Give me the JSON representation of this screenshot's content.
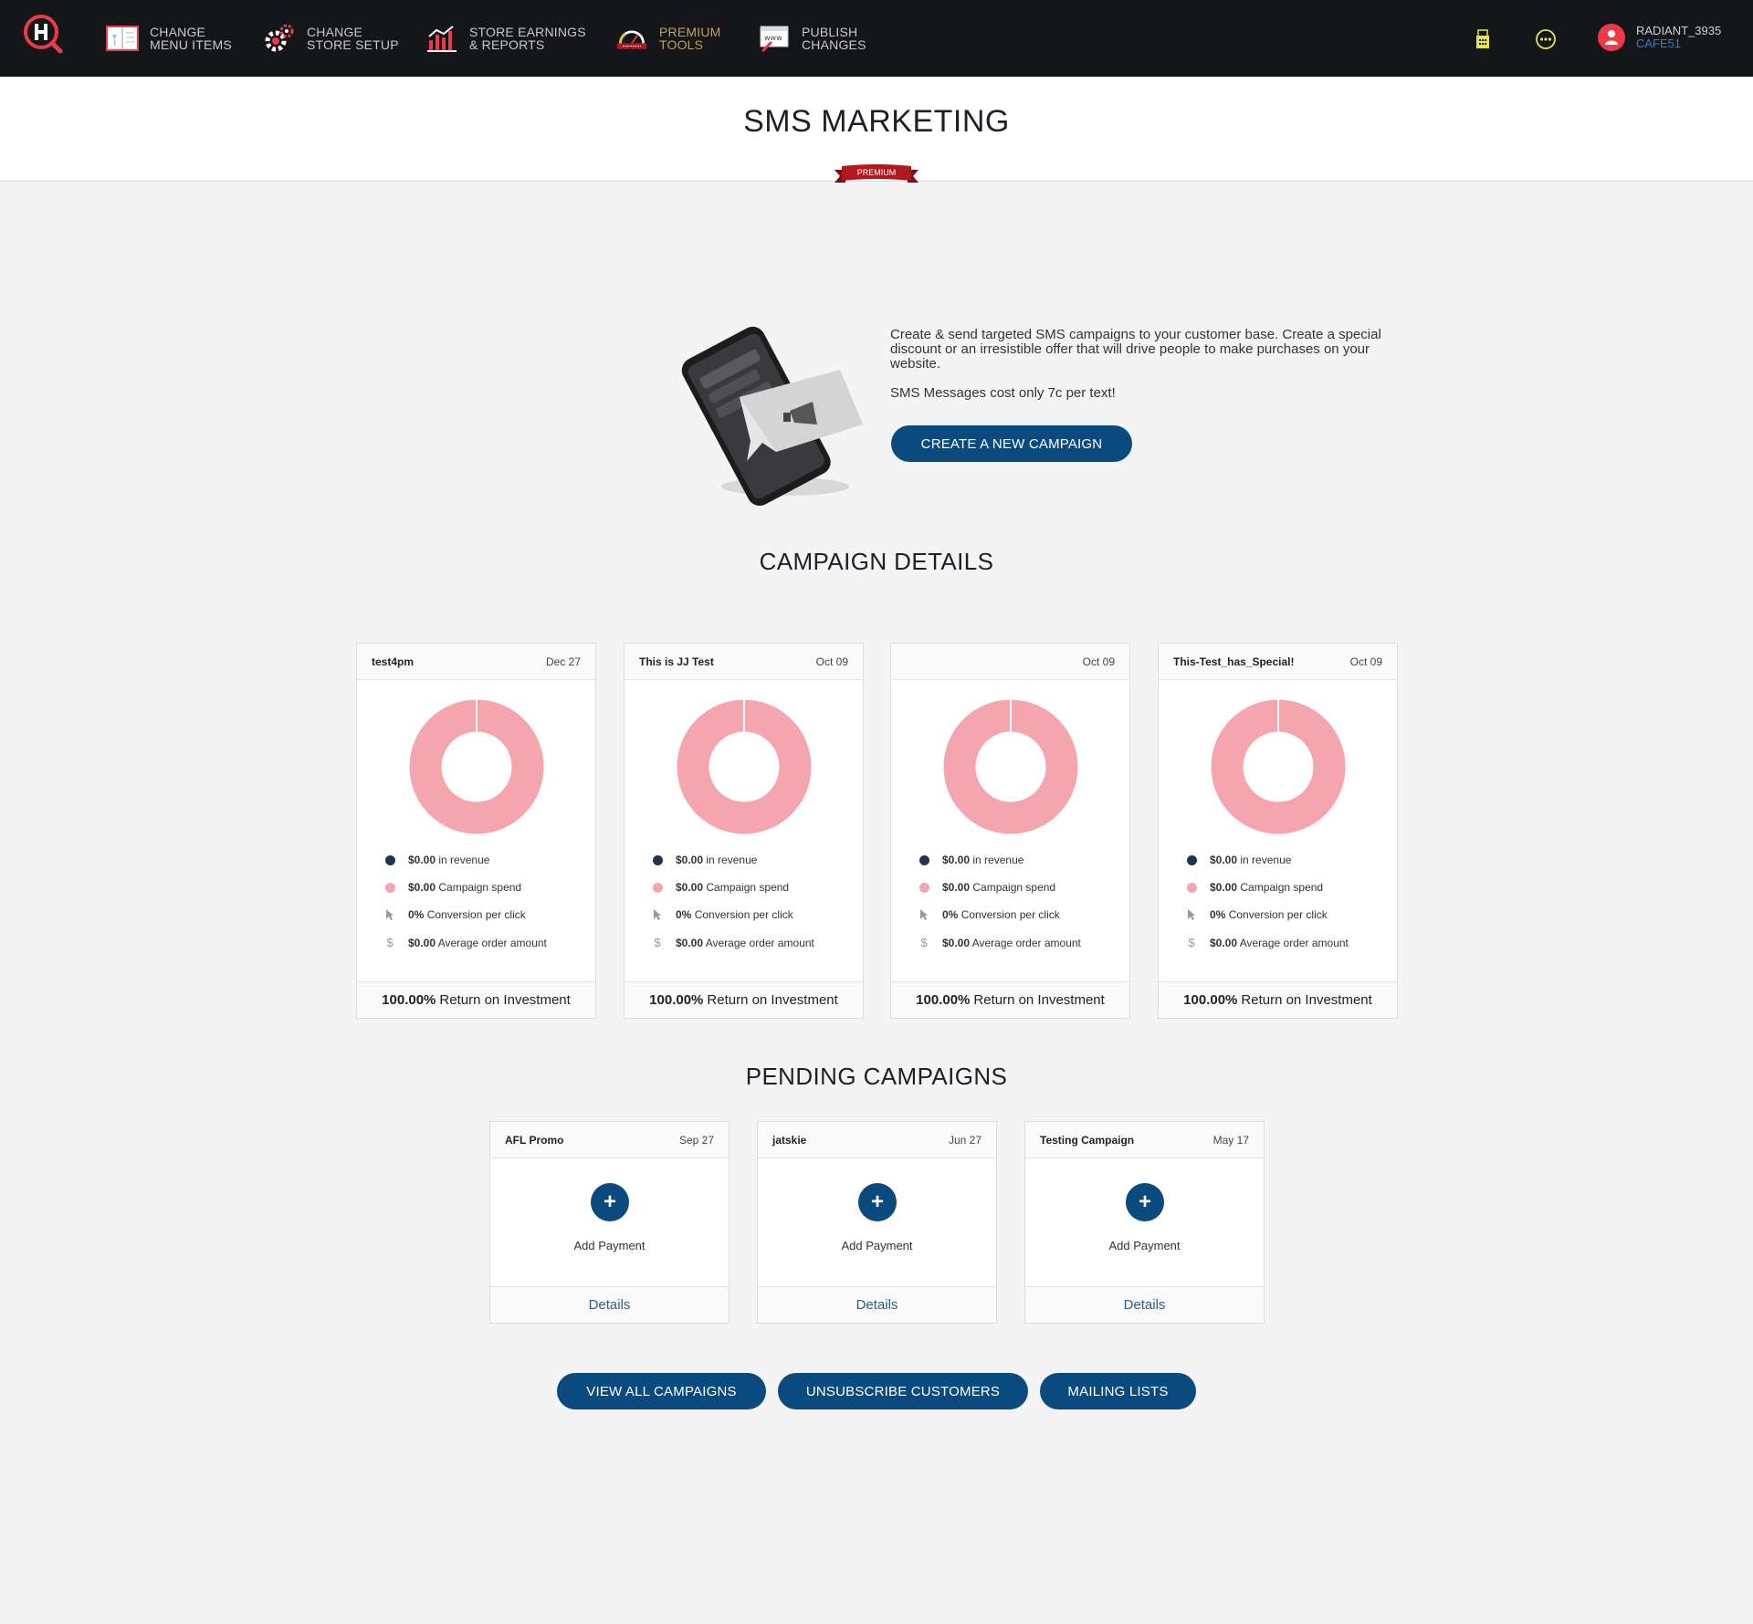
{
  "nav": {
    "items": [
      {
        "line1": "CHANGE",
        "line2": "MENU ITEMS",
        "icon": "menu-book-icon"
      },
      {
        "line1": "CHANGE",
        "line2": "STORE SETUP",
        "icon": "gear-icon"
      },
      {
        "line1": "STORE EARNINGS",
        "line2": "& REPORTS",
        "icon": "bar-chart-icon"
      },
      {
        "line1": "PREMIUM",
        "line2": "TOOLS",
        "icon": "premium-gauge-icon"
      },
      {
        "line1": "PUBLISH",
        "line2": "CHANGES",
        "icon": "publish-web-icon"
      }
    ],
    "user": {
      "name": "RADIANT_3935",
      "store": "CAFE51"
    }
  },
  "page": {
    "title": "SMS MARKETING",
    "badge": "PREMIUM"
  },
  "intro": {
    "description": "Create & send targeted SMS campaigns to your customer base. Create a special discount or an irresistible offer that will drive people to make purchases on your website.",
    "cost_note": "SMS Messages cost only 7c per text!",
    "create_button": "CREATE A NEW CAMPAIGN"
  },
  "campaign_details": {
    "title": "CAMPAIGN DETAILS",
    "cards": [
      {
        "name": "test4pm",
        "date": "Dec 27",
        "revenue": "$0.00",
        "revenue_label": "in revenue",
        "spend": "$0.00",
        "spend_label": "Campaign spend",
        "conversion": "0%",
        "conversion_label": "Conversion per click",
        "avg": "$0.00",
        "avg_label": "Average order amount",
        "roi": "100.00%",
        "roi_label": "Return on Investment"
      },
      {
        "name": "This is JJ Test",
        "date": "Oct 09",
        "revenue": "$0.00",
        "revenue_label": "in revenue",
        "spend": "$0.00",
        "spend_label": "Campaign spend",
        "conversion": "0%",
        "conversion_label": "Conversion per click",
        "avg": "$0.00",
        "avg_label": "Average order amount",
        "roi": "100.00%",
        "roi_label": "Return on Investment"
      },
      {
        "name": "",
        "date": "Oct 09",
        "revenue": "$0.00",
        "revenue_label": "in revenue",
        "spend": "$0.00",
        "spend_label": "Campaign spend",
        "conversion": "0%",
        "conversion_label": "Conversion per click",
        "avg": "$0.00",
        "avg_label": "Average order amount",
        "roi": "100.00%",
        "roi_label": "Return on Investment"
      },
      {
        "name": "This-Test_has_Special!",
        "date": "Oct 09",
        "revenue": "$0.00",
        "revenue_label": "in revenue",
        "spend": "$0.00",
        "spend_label": "Campaign spend",
        "conversion": "0%",
        "conversion_label": "Conversion per click",
        "avg": "$0.00",
        "avg_label": "Average order amount",
        "roi": "100.00%",
        "roi_label": "Return on Investment"
      }
    ]
  },
  "pending": {
    "title": "PENDING CAMPAIGNS",
    "cards": [
      {
        "name": "AFL Promo",
        "date": "Sep 27",
        "action": "Add Payment",
        "details": "Details"
      },
      {
        "name": "jatskie",
        "date": "Jun 27",
        "action": "Add Payment",
        "details": "Details"
      },
      {
        "name": "Testing Campaign",
        "date": "May 17",
        "action": "Add Payment",
        "details": "Details"
      }
    ]
  },
  "bottom_buttons": {
    "view_all": "VIEW ALL CAMPAIGNS",
    "unsubscribe": "UNSUBSCRIBE CUSTOMERS",
    "mailing": "MAILING LISTS"
  },
  "colors": {
    "navbar": "#141619",
    "accent_blue": "#0b4a7e",
    "donut_pink": "#f4a5ad",
    "revenue_dot": "#1d3550",
    "premium_gold": "#c7a14a",
    "brand_red": "#ec3a46"
  }
}
